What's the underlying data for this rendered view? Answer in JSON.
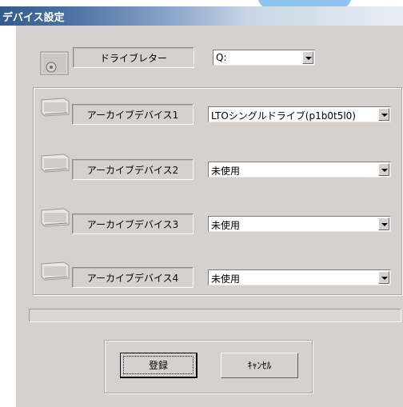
{
  "window": {
    "title": "デバイス設定"
  },
  "drive_letter": {
    "label": "ドライブレター",
    "value": "Q:"
  },
  "archive_devices": [
    {
      "label": "アーカイブデバイス1",
      "value": "LTOシングルドライブ(p1b0t5l0)"
    },
    {
      "label": "アーカイブデバイス2",
      "value": "未使用"
    },
    {
      "label": "アーカイブデバイス3",
      "value": "未使用"
    },
    {
      "label": "アーカイブデバイス4",
      "value": "未使用"
    }
  ],
  "progress": {
    "value": 0
  },
  "buttons": {
    "register": "登録",
    "cancel": "ｷｬﾝｾﾙ"
  },
  "colors": {
    "dialog_bg": "#d5d1ce",
    "titlebar_start": "#355a8c",
    "titlebar_end": "#e9eef5"
  },
  "icons": {
    "drive_letter": "cd-drive-icon",
    "archive_device": "tape-drive-icon",
    "dropdown": "chevron-down-icon"
  }
}
